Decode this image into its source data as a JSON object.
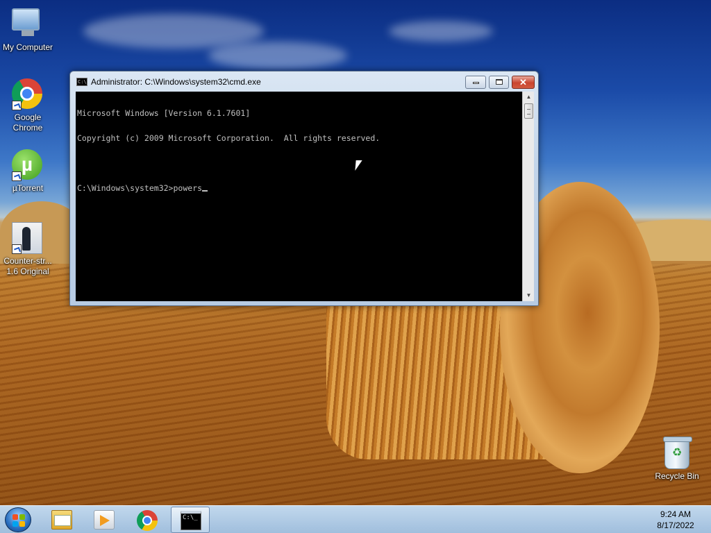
{
  "desktop": {
    "icons": [
      {
        "label_1": "My Computer",
        "label_2": "",
        "icon": "computer-icon"
      },
      {
        "label_1": "Google",
        "label_2": "Chrome",
        "icon": "chrome-icon"
      },
      {
        "label_1": "µTorrent",
        "label_2": "",
        "icon": "utorrent-icon"
      },
      {
        "label_1": "Counter-str...",
        "label_2": "1.6 Original",
        "icon": "counter-strike-icon"
      }
    ],
    "recycle_bin": {
      "label": "Recycle Bin",
      "icon": "recycle-bin-icon"
    },
    "utorrent_glyph": "µ"
  },
  "window": {
    "title": "Administrator: C:\\Windows\\system32\\cmd.exe",
    "icon_glyph": "C:\\",
    "close_glyph": "✕",
    "console_lines": [
      "Microsoft Windows [Version 6.1.7601]",
      "Copyright (c) 2009 Microsoft Corporation.  All rights reserved.",
      "",
      "C:\\Windows\\system32>powers"
    ],
    "scroll_up_glyph": "▲",
    "scroll_down_glyph": "▼"
  },
  "taskbar": {
    "cmd_glyph": "C:\\_",
    "time": "9:24 AM",
    "date": "8/17/2022"
  },
  "colors": {
    "console_bg": "#000000",
    "console_fg": "#c0c0c0",
    "taskbar": "#aecbe6"
  }
}
